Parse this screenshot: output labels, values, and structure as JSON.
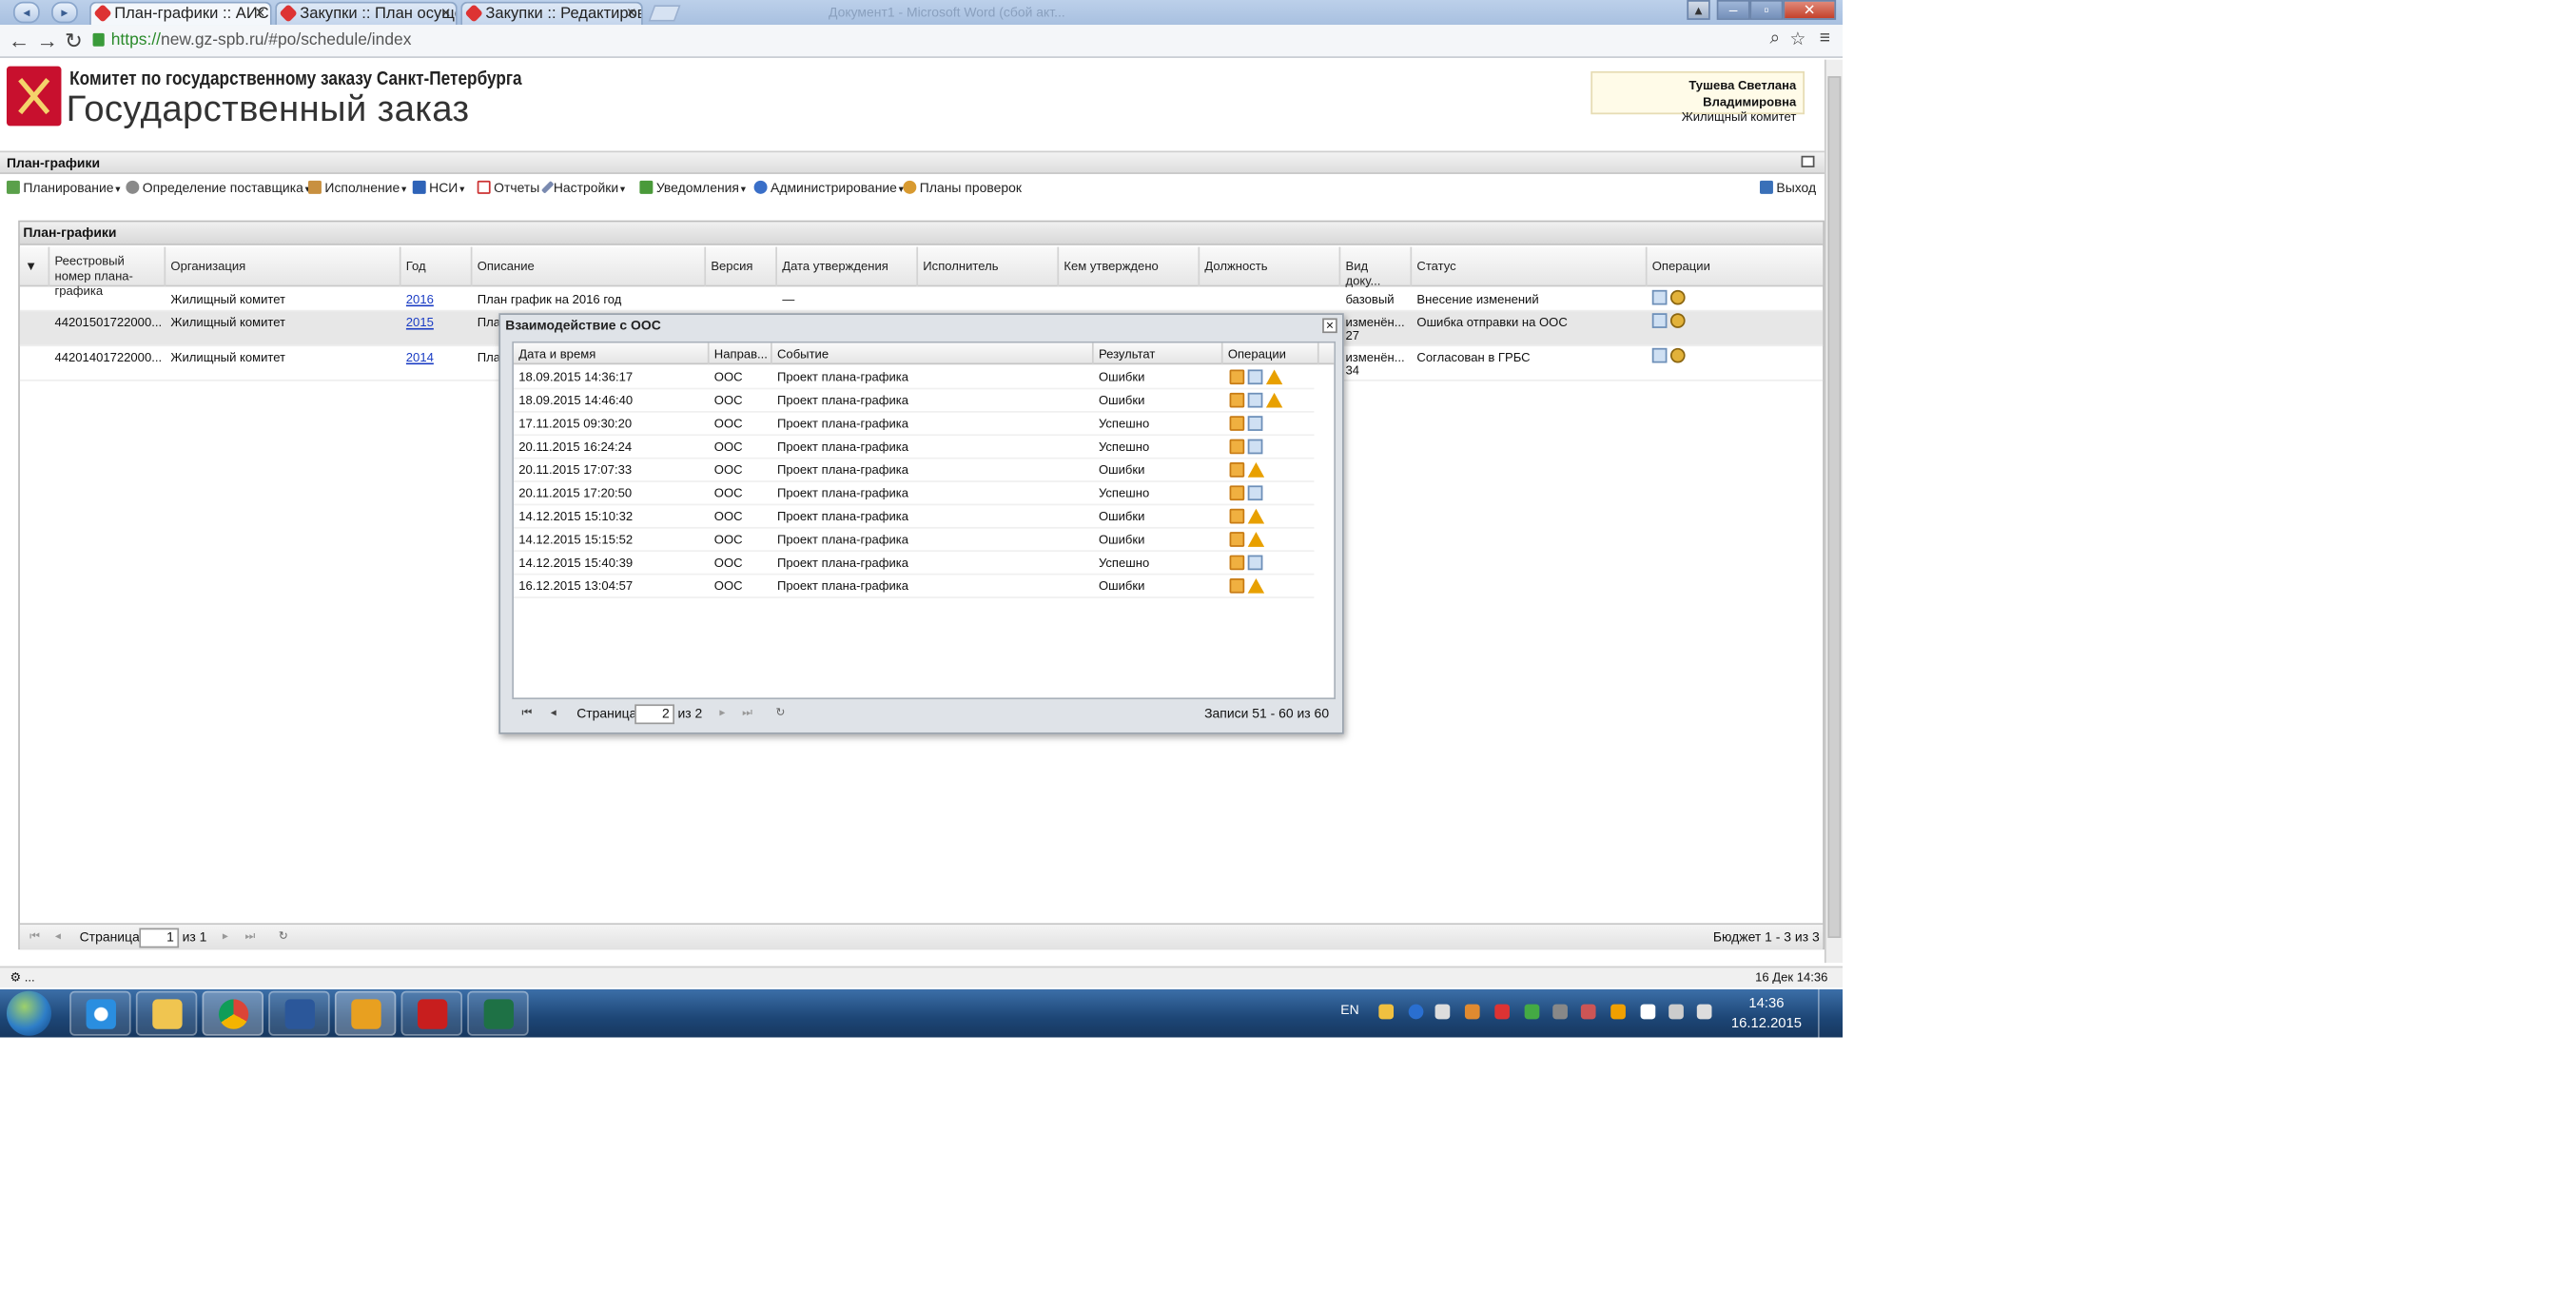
{
  "browser": {
    "tabs": [
      {
        "label": "План-графики :: АИС"
      },
      {
        "label": "Закупки :: План осуще"
      },
      {
        "label": "Закупки :: Редактиров"
      }
    ],
    "ghost_tab": "Документ1 - Microsoft Word (сбой акт...",
    "url_scheme": "https://",
    "url_rest": "new.gz-spb.ru/#po/schedule/index"
  },
  "header": {
    "org": "Комитет по государственному заказу Санкт-Петербурга",
    "site": "Государственный заказ",
    "user_name": "Тушева Светлана Владимировна",
    "user_dept": "Жилищный комитет"
  },
  "section_title": "План-графики",
  "menu": {
    "planning": "Планирование",
    "supplier": "Определение поставщика",
    "execution": "Исполнение",
    "nsi": "НСИ",
    "reports": "Отчеты",
    "settings": "Настройки",
    "notifications": "Уведомления",
    "admin": "Администрирование",
    "plans": "Планы проверок",
    "exit": "Выход"
  },
  "grid": {
    "title": "План-графики",
    "columns": {
      "reg": "Реестровый номер плана-графика",
      "org": "Организация",
      "year": "Год",
      "desc": "Описание",
      "ver": "Версия",
      "date": "Дата утверждения",
      "exec": "Исполнитель",
      "approved": "Кем утверждено",
      "pos": "Должность",
      "doctype": "Вид доку...",
      "status": "Статус",
      "ops": "Операции"
    },
    "rows": [
      {
        "reg": "",
        "org": "Жилищный комитет",
        "year": "2016",
        "desc": "План график на 2016 год",
        "date": "—",
        "doctype": "базовый",
        "doctype2": "",
        "status": "Внесение изменений"
      },
      {
        "reg": "44201501722000...",
        "org": "Жилищный комитет",
        "year": "2015",
        "desc": "План",
        "date": "",
        "doctype": "изменён...",
        "doctype2": "27",
        "status": "Ошибка отправки на ООС"
      },
      {
        "reg": "44201401722000...",
        "org": "Жилищный комитет",
        "year": "2014",
        "desc": "План",
        "date": "",
        "doctype": "изменён...",
        "doctype2": "34",
        "status": "Согласован в ГРБС"
      }
    ],
    "pager": {
      "page_label": "Страница",
      "page": "1",
      "of": "из 1",
      "info": "Бюджет 1 - 3 из 3"
    }
  },
  "dialog": {
    "title": "Взаимодействие с ООС",
    "columns": {
      "datetime": "Дата и время",
      "dir": "Направ...",
      "event": "Событие",
      "result": "Результат",
      "ops": "Операции"
    },
    "rows": [
      {
        "datetime": "18.09.2015 14:36:17",
        "dir": "ООС",
        "event": "Проект плана-графика",
        "result": "Ошибки",
        "warn": true
      },
      {
        "datetime": "18.09.2015 14:46:40",
        "dir": "ООС",
        "event": "Проект плана-графика",
        "result": "Ошибки",
        "warn": true
      },
      {
        "datetime": "17.11.2015 09:30:20",
        "dir": "ООС",
        "event": "Проект плана-графика",
        "result": "Успешно",
        "warn": false
      },
      {
        "datetime": "20.11.2015 16:24:24",
        "dir": "ООС",
        "event": "Проект плана-графика",
        "result": "Успешно",
        "warn": false
      },
      {
        "datetime": "20.11.2015 17:07:33",
        "dir": "ООС",
        "event": "Проект плана-графика",
        "result": "Ошибки",
        "warn": true
      },
      {
        "datetime": "20.11.2015 17:20:50",
        "dir": "ООС",
        "event": "Проект плана-графика",
        "result": "Успешно",
        "warn": false
      },
      {
        "datetime": "14.12.2015 15:10:32",
        "dir": "ООС",
        "event": "Проект плана-графика",
        "result": "Ошибки",
        "warn": true
      },
      {
        "datetime": "14.12.2015 15:15:52",
        "dir": "ООС",
        "event": "Проект плана-графика",
        "result": "Ошибки",
        "warn": true
      },
      {
        "datetime": "14.12.2015 15:40:39",
        "dir": "ООС",
        "event": "Проект плана-графика",
        "result": "Успешно",
        "warn": false
      },
      {
        "datetime": "16.12.2015 13:04:57",
        "dir": "ООС",
        "event": "Проект плана-графика",
        "result": "Ошибки",
        "warn": true
      }
    ],
    "pager": {
      "page_label": "Страница",
      "page": "2",
      "of": "из 2",
      "info": "Записи 51 - 60 из 60"
    }
  },
  "status_bar": {
    "left": "⚙ ...",
    "right": "16 Дек 14:36"
  },
  "taskbar": {
    "lang": "EN",
    "time": "14:36",
    "date": "16.12.2015"
  }
}
